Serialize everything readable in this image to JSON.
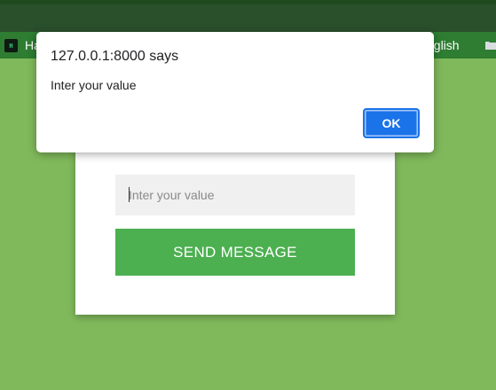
{
  "bookmarks": {
    "left_label": "Ha",
    "right_label": "nglish",
    "left_icon_text": "H"
  },
  "form": {
    "input_placeholder": "Inter your value",
    "input_value": "",
    "send_label": "SEND MESSAGE"
  },
  "dialog": {
    "title": "127.0.0.1:8000 says",
    "message": "Inter your value",
    "ok_label": "OK"
  },
  "colors": {
    "page_background": "#80b95c",
    "send_button": "#4caf50",
    "ok_button": "#1a73e8"
  }
}
